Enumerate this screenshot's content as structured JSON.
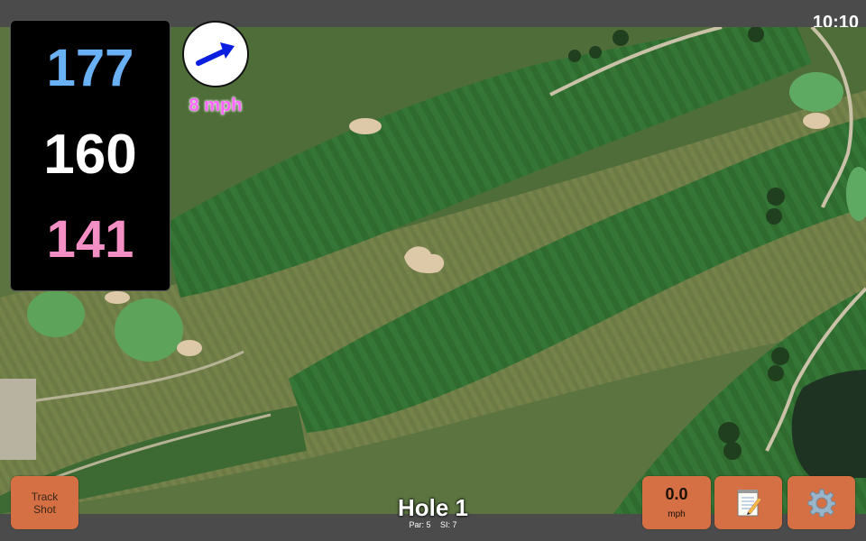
{
  "status": {
    "clock": "10:10"
  },
  "distances": {
    "back": "177",
    "middle": "160",
    "front": "141"
  },
  "wind": {
    "speed": "8 mph",
    "direction_icon": "wind-arrow-icon",
    "arrow_color": "#0a1ee0"
  },
  "hole": {
    "title": "Hole 1",
    "par": "Par: 5",
    "si": "SI: 7"
  },
  "buttons": {
    "track_shot": "Track\nShot",
    "speed_value": "0.0",
    "speed_unit": "mph",
    "notes_icon": "notepad-icon",
    "settings_icon": "gear-icon"
  },
  "colors": {
    "back_distance": "#6ab0f5",
    "middle_distance": "#ffffff",
    "front_distance": "#f48fc6",
    "button": "#d47043",
    "wind_text": "#ff66ff"
  }
}
